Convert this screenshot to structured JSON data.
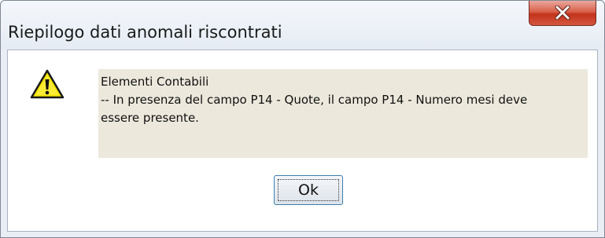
{
  "dialog": {
    "title": "Riepilogo dati anomali riscontrati",
    "close_icon": "close-icon",
    "warning_icon": "warning-triangle-icon"
  },
  "message": {
    "line1": "Elementi Contabili",
    "line2": "-- In presenza del campo P14 - Quote, il campo P14 - Numero mesi  deve",
    "line3": "essere presente."
  },
  "buttons": {
    "ok_label": "Ok"
  },
  "colors": {
    "message_background": "#ece8dc",
    "close_button": "#c2341c",
    "warning_yellow": "#f5e400"
  }
}
